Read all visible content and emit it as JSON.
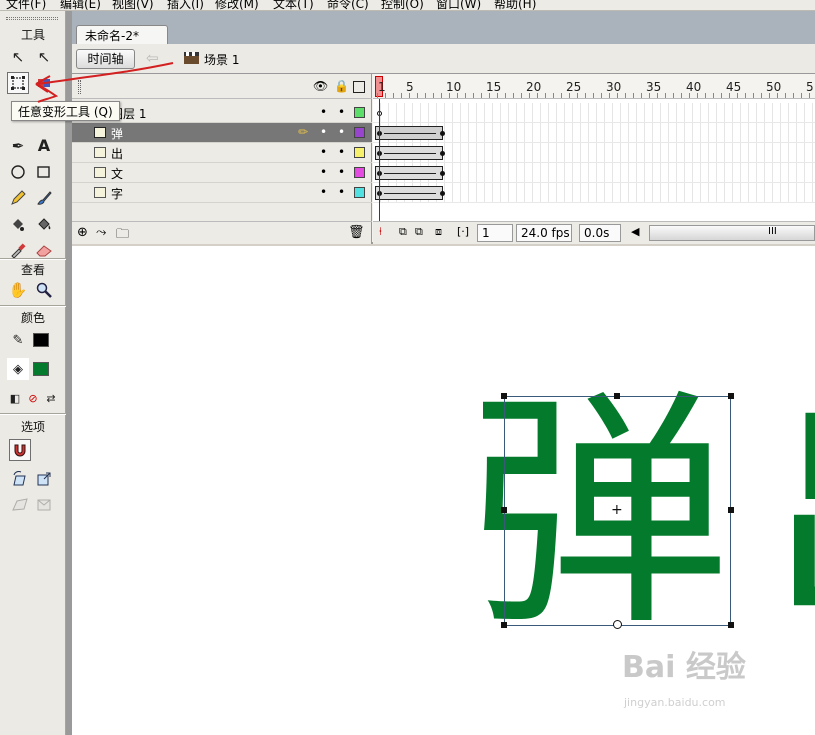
{
  "menu": [
    "文件(F)",
    "编辑(E)",
    "视图(V)",
    "插入(I)",
    "修改(M)",
    "文本(T)",
    "命令(C)",
    "控制(O)",
    "窗口(W)",
    "帮助(H)"
  ],
  "tools": {
    "section_tools": "工具",
    "section_view": "查看",
    "section_colors": "颜色",
    "section_options": "选项",
    "tooltip": "任意变形工具 (Q)",
    "stroke_color": "#000000",
    "fill_color": "#047b2c",
    "icons": [
      "selection-arrow-icon",
      "subselect-arrow-icon",
      "free-transform-icon",
      "gradient-transform-icon",
      "pen-icon",
      "text-icon",
      "oval-icon",
      "rectangle-icon",
      "pencil-icon",
      "brush-icon",
      "ink-bottle-icon",
      "paint-bucket-icon",
      "eyedropper-icon",
      "eraser-icon",
      "hand-icon",
      "zoom-icon",
      "magnet-icon",
      "rotate-skew-icon",
      "scale-icon",
      "distort-icon",
      "envelope-icon"
    ]
  },
  "document": {
    "tab": "未命名-2*",
    "timeline_button": "时间轴",
    "scene": "场景 1"
  },
  "layers": [
    {
      "name": "图层 1",
      "color": "#5dde6a",
      "selected": false
    },
    {
      "name": "弹",
      "color": "#9944cc",
      "selected": true
    },
    {
      "name": "出",
      "color": "#f7f06a",
      "selected": false
    },
    {
      "name": "文",
      "color": "#e44be0",
      "selected": false
    },
    {
      "name": "字",
      "color": "#52e0e0",
      "selected": false
    }
  ],
  "ruler": [
    "1",
    "5",
    "10",
    "15",
    "20",
    "25",
    "30",
    "35",
    "40",
    "45",
    "50",
    "5"
  ],
  "status": {
    "frame": "1",
    "fps": "24.0 fps",
    "time": "0.0s",
    "scroll_label": "III"
  },
  "stage": {
    "char_main": "弹",
    "char_next": "出",
    "watermark": "Bai 经验",
    "watermark_url": "jingyan.baidu.com"
  }
}
